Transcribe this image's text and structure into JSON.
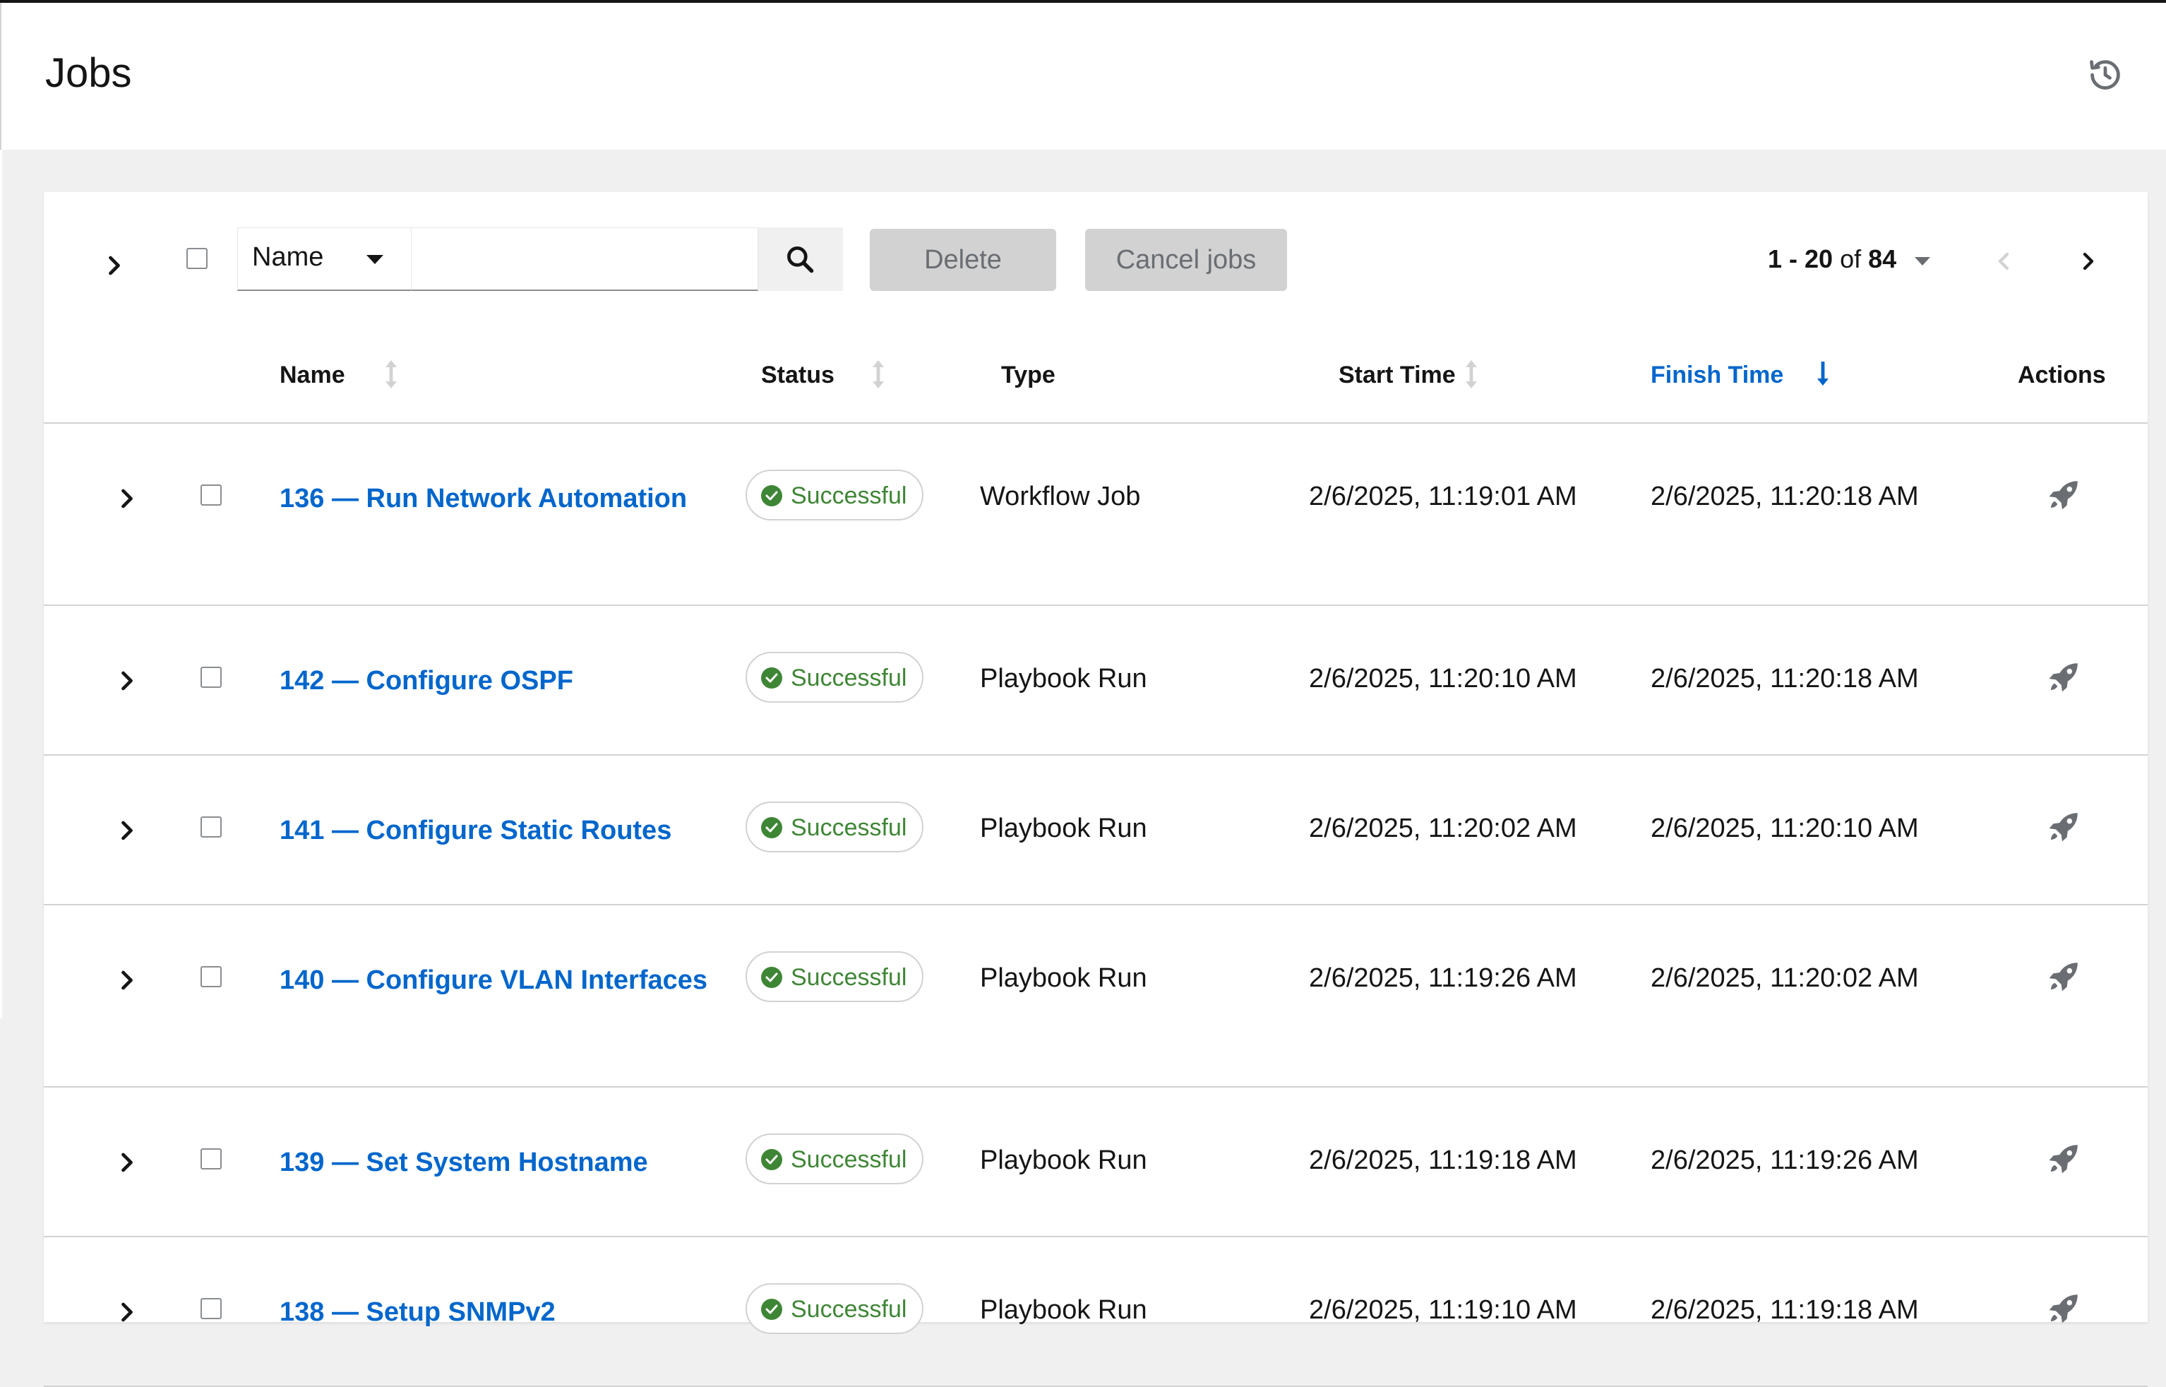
{
  "page": {
    "title": "Jobs",
    "history_icon": "history-icon"
  },
  "toolbar": {
    "expand_icon": "chevron-right-icon",
    "filter_attribute": "Name",
    "search_value": "",
    "search_placeholder": "",
    "search_icon": "search-icon",
    "delete_label": "Delete",
    "cancel_label": "Cancel jobs",
    "pagination": {
      "range": "1 - 20",
      "of": "of",
      "total": "84"
    }
  },
  "columns": {
    "name": "Name",
    "status": "Status",
    "type": "Type",
    "start_time": "Start Time",
    "finish_time": "Finish Time",
    "actions": "Actions"
  },
  "sort": {
    "column": "finish_time",
    "direction": "descending"
  },
  "rows": [
    {
      "name": "136 — Run Network Automation",
      "status": "Successful",
      "type": "Workflow Job",
      "start": "2/6/2025, 11:19:01 AM",
      "finish": "2/6/2025, 11:20:18 AM"
    },
    {
      "name": "142 — Configure OSPF",
      "status": "Successful",
      "type": "Playbook Run",
      "start": "2/6/2025, 11:20:10 AM",
      "finish": "2/6/2025, 11:20:18 AM"
    },
    {
      "name": "141 — Configure Static Routes",
      "status": "Successful",
      "type": "Playbook Run",
      "start": "2/6/2025, 11:20:02 AM",
      "finish": "2/6/2025, 11:20:10 AM"
    },
    {
      "name": "140 — Configure VLAN Interfaces",
      "status": "Successful",
      "type": "Playbook Run",
      "start": "2/6/2025, 11:19:26 AM",
      "finish": "2/6/2025, 11:20:02 AM"
    },
    {
      "name": "139 — Set System Hostname",
      "status": "Successful",
      "type": "Playbook Run",
      "start": "2/6/2025, 11:19:18 AM",
      "finish": "2/6/2025, 11:19:26 AM"
    },
    {
      "name": "138 — Setup SNMPv2",
      "status": "Successful",
      "type": "Playbook Run",
      "start": "2/6/2025, 11:19:10 AM",
      "finish": "2/6/2025, 11:19:18 AM"
    }
  ],
  "colors": {
    "link": "#0066cc",
    "success": "#3e8635",
    "border": "#d2d2d2",
    "background": "#f0f0f0"
  }
}
